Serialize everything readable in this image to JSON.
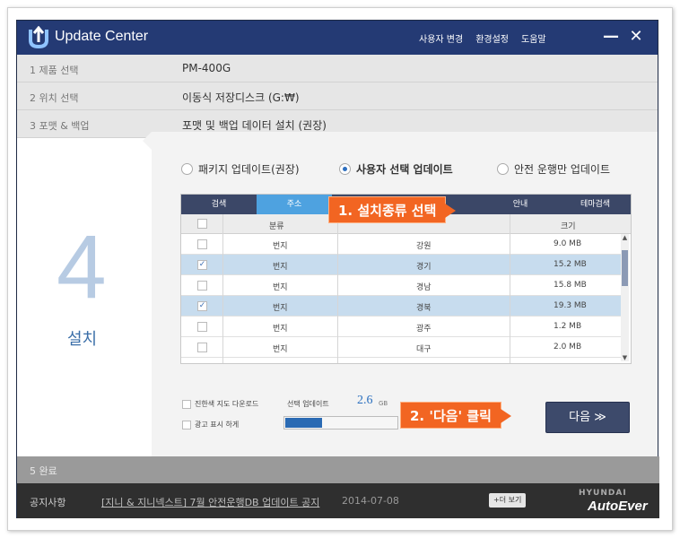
{
  "titlebar": {
    "title": "Update Center",
    "links": [
      "사용자 변경",
      "환경설정",
      "도움말"
    ],
    "minimize": "—",
    "close": "✕"
  },
  "steps": [
    {
      "label": "1  제품 선택",
      "value": "PM-400G"
    },
    {
      "label": "2  위치 선택",
      "value": "이동식 저장디스크 (G:₩)"
    },
    {
      "label": "3  포맷 & 백업",
      "value": "포맷 및 백업 데이터 설치 (권장)"
    }
  ],
  "current_step": {
    "number": "4",
    "name": "설치"
  },
  "radios": [
    {
      "label": "패키지 업데이트(권장)",
      "selected": false
    },
    {
      "label": "사용자 선택 업데이트",
      "selected": true
    },
    {
      "label": "안전 운행만 업데이트",
      "selected": false
    }
  ],
  "tabs": [
    "검색",
    "주소",
    "",
    "",
    "안내",
    "테마검색"
  ],
  "active_tab": 1,
  "columns": [
    "분류",
    "",
    "크기"
  ],
  "rows": [
    {
      "checked": false,
      "type": "번지",
      "region": "강원",
      "size": "9.0 MB"
    },
    {
      "checked": true,
      "type": "번지",
      "region": "경기",
      "size": "15.2 MB"
    },
    {
      "checked": false,
      "type": "번지",
      "region": "경남",
      "size": "15.8 MB"
    },
    {
      "checked": true,
      "type": "번지",
      "region": "경북",
      "size": "19.3 MB"
    },
    {
      "checked": false,
      "type": "번지",
      "region": "광주",
      "size": "1.2 MB"
    },
    {
      "checked": false,
      "type": "번지",
      "region": "대구",
      "size": "2.0 MB"
    }
  ],
  "callouts": {
    "install_type": "1. 설치종류 선택",
    "next_click": "2. '다음' 클릭"
  },
  "options": {
    "partial_map": "진한색 지도 다운로드",
    "ads": "광고 표시 하게"
  },
  "selection": {
    "label": "선택 업데이트",
    "size": "2.6",
    "unit": "GB",
    "progress_fraction": 0.33
  },
  "next_button": "다음 ≫",
  "finish_step": "5  완료",
  "notice": {
    "label": "공지사항",
    "message": "[지니 & 지니넥스트] 7월 안전운행DB 업데이트 공지",
    "date": "2014-07-08",
    "more": "+더 보기",
    "brand_top": "HYUNDAI",
    "brand_bottom": "AutoEver"
  },
  "colors": {
    "titlebar": "#243a74",
    "accent": "#2e6fbf",
    "callout": "#f26522",
    "selected_row": "#c7dcee"
  }
}
